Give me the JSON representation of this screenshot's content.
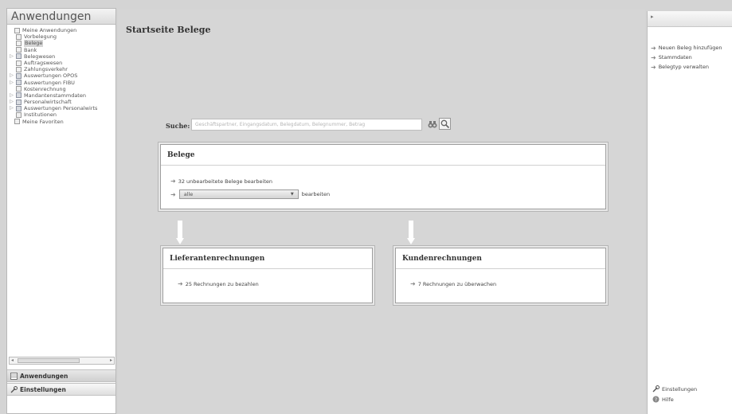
{
  "left_panel": {
    "title": "Anwendungen",
    "tree": [
      {
        "label": "Meine Anwendungen",
        "level": 0,
        "icon": "page",
        "expander": ""
      },
      {
        "label": "Vorbelegung",
        "level": 1,
        "icon": "page",
        "expander": ""
      },
      {
        "label": "Belege",
        "level": 1,
        "icon": "page",
        "expander": "",
        "selected": true
      },
      {
        "label": "Bank",
        "level": 1,
        "icon": "page",
        "expander": ""
      },
      {
        "label": "Belegwesen",
        "level": 1,
        "icon": "folder",
        "expander": "▷"
      },
      {
        "label": "Auftragswesen",
        "level": 1,
        "icon": "page",
        "expander": ""
      },
      {
        "label": "Zahlungsverkehr",
        "level": 1,
        "icon": "page",
        "expander": ""
      },
      {
        "label": "Auswertungen OPOS",
        "level": 1,
        "icon": "folder",
        "expander": "▷"
      },
      {
        "label": "Auswertungen FIBU",
        "level": 1,
        "icon": "folder",
        "expander": "▷"
      },
      {
        "label": "Kostenrechnung",
        "level": 1,
        "icon": "page",
        "expander": ""
      },
      {
        "label": "Mandantenstammdaten",
        "level": 1,
        "icon": "folder",
        "expander": "▷"
      },
      {
        "label": "Personalwirtschaft",
        "level": 1,
        "icon": "folder",
        "expander": "▷"
      },
      {
        "label": "Auswertungen Personalwirts",
        "level": 1,
        "icon": "folder",
        "expander": "▷"
      },
      {
        "label": "Institutionen",
        "level": 1,
        "icon": "page",
        "expander": ""
      },
      {
        "label": "Meine Favoriten",
        "level": 0,
        "icon": "page",
        "expander": ""
      }
    ],
    "nav_apps": "Anwendungen",
    "nav_settings": "Einstellungen"
  },
  "main": {
    "title": "Startseite Belege",
    "search": {
      "label": "Suche:",
      "placeholder": "Geschäftspartner, Eingangsdatum, Belegdatum, Belegnummer, Betrag"
    },
    "belege": {
      "title": "Belege",
      "link": "32 unbearbeitete Belege bearbeiten",
      "select_value": "alle",
      "select_suffix": "bearbeiten"
    },
    "lieferanten": {
      "title": "Lieferantenrechnungen",
      "link": "25 Rechnungen zu bezahlen"
    },
    "kunden": {
      "title": "Kundenrechnungen",
      "link": "7 Rechnungen zu überwachen"
    }
  },
  "right_panel": {
    "top_arrow": "▸",
    "links": [
      "Neuen Beleg hinzufügen",
      "Stammdaten",
      "Belegtyp verwalten"
    ],
    "settings": "Einstellungen",
    "help": "Hilfe"
  },
  "icons": {
    "arrow": "➜",
    "expander": "▷",
    "binoculars": "binoculars-icon",
    "magnifier": "magnifier-icon",
    "wrench": "wrench-icon",
    "help": "help-icon"
  }
}
